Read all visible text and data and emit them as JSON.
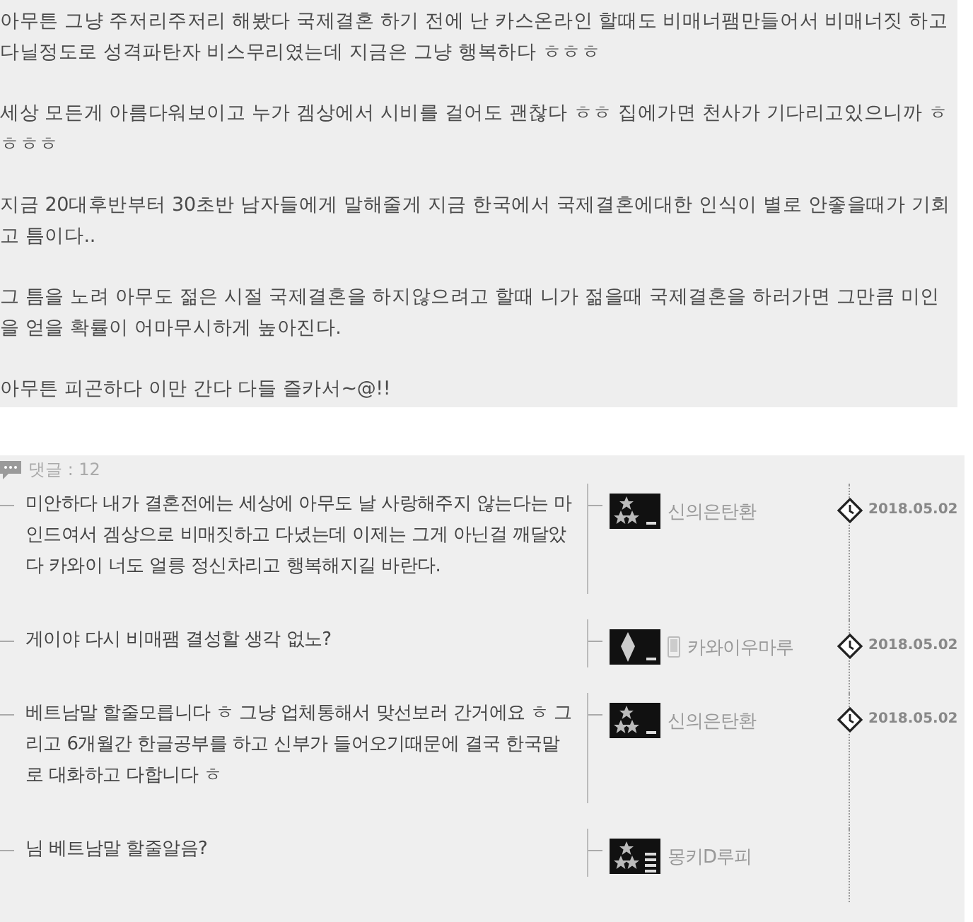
{
  "post": {
    "paragraphs": [
      [
        "아무튼 그냥 주저리주저리 해봤다 국제결혼 하기 전에 난 카스온라인 할때도 비매너팸만들어서 비매너짓 하고 다닐정도로 성격파탄자 비스무리였는데 지금은 그냥 행복하다 ㅎㅎㅎ"
      ],
      [
        "세상 모든게 아름다워보이고 누가 겜상에서 시비를 걸어도 괜찮다 ㅎㅎ 집에가면 천사가 기다리고있으니까 ㅎㅎㅎㅎ"
      ],
      [
        "지금 20대후반부터 30초반 남자들에게 말해줄게 지금 한국에서 국제결혼에대한 인식이 별로 안좋을때가 기회고 틈이다.."
      ],
      [
        "그 틈을 노려 아무도 젊은 시절 국제결혼을 하지않으려고 할때 니가 젊을때 국제결혼을 하러가면 그만큼 미인을 얻을 확률이 어마무시하게 높아진다."
      ],
      [
        "아무튼 피곤하다 이만 간다 다들 즐카서~@!!"
      ]
    ]
  },
  "comments_header": {
    "label": "댓글 : 12"
  },
  "comments": [
    {
      "text": "미안하다 내가 결혼전에는 세상에 아무도 날 사랑해주지 않는다는 마인드여서 겜상으로 비매짓하고 다녔는데 이제는 그게 아닌걸 깨달았다 카와이 너도 얼릉 정신차리고 행복해지길 바란다.",
      "kind": "stars",
      "mobile": false,
      "author": "신의은탄환",
      "date": "2018.05.02"
    },
    {
      "text": "게이야 다시 비매팸 결성할 생각 없노?",
      "kind": "gem",
      "mobile": true,
      "author": "카와이우마루",
      "date": "2018.05.02"
    },
    {
      "text": "베트남말 할줄모릅니다 ㅎ 그냥 업체통해서 맞선보러 간거에요 ㅎ 그리고 6개월간 한글공부를 하고 신부가 들어오기때문에 결국 한국말로 대화하고 다합니다 ㅎ",
      "kind": "stars",
      "mobile": false,
      "author": "신의은탄환",
      "date": "2018.05.02"
    },
    {
      "text": "님 베트남말 할줄알음?",
      "kind": "stars-bars",
      "mobile": false,
      "author": "몽키D루피"
    }
  ]
}
